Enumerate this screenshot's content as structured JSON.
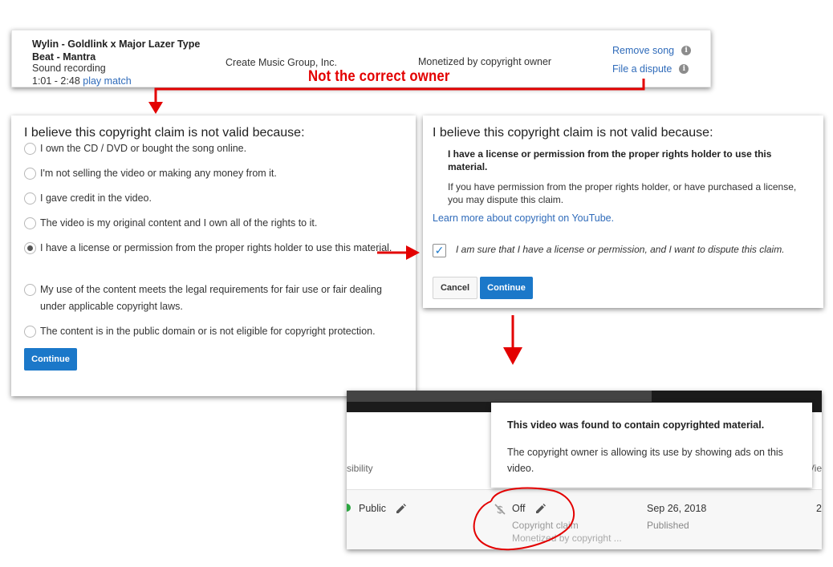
{
  "claim": {
    "song_title": "Wylin - Goldlink x Major Lazer Type Beat - Mantra",
    "content_type": "Sound recording",
    "time_range": "1:01 - 2:48",
    "play_match": "play match",
    "claimant": "Create Music Group, Inc.",
    "policy": "Monetized by copyright owner",
    "remove_song": "Remove song",
    "file_dispute": "File a dispute"
  },
  "annotation": {
    "text": "Not the correct owner",
    "color": "#e30000"
  },
  "reason_form": {
    "heading": "I believe this copyright claim is not valid because:",
    "options": [
      {
        "label": "I own the CD / DVD or bought the song online.",
        "selected": false
      },
      {
        "label": "I'm not selling the video or making any money from it.",
        "selected": false
      },
      {
        "label": "I gave credit in the video.",
        "selected": false
      },
      {
        "label": "The video is my original content and I own all of the rights to it.",
        "selected": false
      },
      {
        "label": "I have a license or permission from the proper rights holder to use this material.",
        "selected": true
      },
      {
        "label": "My use of the content meets the legal requirements for fair use or fair dealing under applicable copyright laws.",
        "selected": false
      },
      {
        "label": "The content is in the public domain or is not eligible for copyright protection.",
        "selected": false
      }
    ],
    "continue_label": "Continue"
  },
  "license_form": {
    "heading": "I believe this copyright claim is not valid because:",
    "bold_text": "I have a license or permission from the proper rights holder to use this material.",
    "body_text": "If you have permission from the proper rights holder, or have purchased a license, you may dispute this claim.",
    "learn_more": "Learn more about copyright on YouTube.",
    "confirm_text": "I am sure that I have a license or permission, and I want to dispute this claim.",
    "confirm_checked": true,
    "cancel_label": "Cancel",
    "continue_label": "Continue"
  },
  "video_row": {
    "visibility_header": "sibility",
    "views_header": "Vie",
    "visibility_value": "Public",
    "monetization_value": "Off",
    "claim_label": "Copyright claim",
    "claim_sub": "Monetized by copyright ...",
    "date": "Sep 26, 2018",
    "date_label": "Published",
    "views_value": "2"
  },
  "tooltip": {
    "title": "This video was found to contain copyrighted material.",
    "body": "The copyright owner is allowing its use by showing ads on this video."
  },
  "colors": {
    "link": "#2f6bba",
    "primary_button": "#1b78c9",
    "arrow": "#e30000",
    "public_dot": "#2ba640"
  }
}
